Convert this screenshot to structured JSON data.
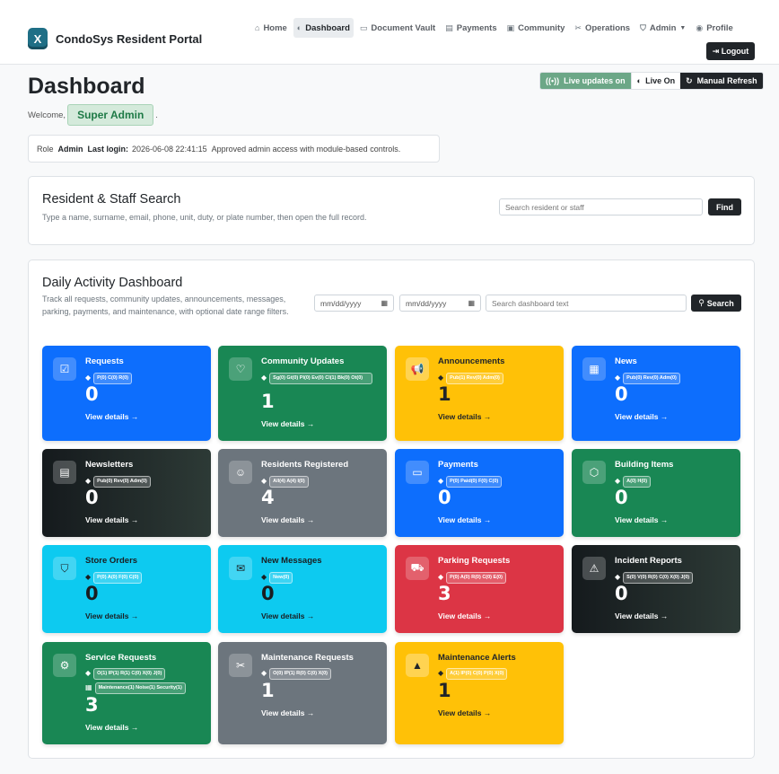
{
  "brand": {
    "logo_text": "X",
    "name": "CondoSys Resident Portal"
  },
  "nav": [
    {
      "label": "Home",
      "icon": "⌂"
    },
    {
      "label": "Dashboard",
      "icon": "◐"
    },
    {
      "label": "Document Vault",
      "icon": "▭"
    },
    {
      "label": "Payments",
      "icon": "▤"
    },
    {
      "label": "Community",
      "icon": "▣"
    },
    {
      "label": "Operations",
      "icon": "✂"
    },
    {
      "label": "Admin",
      "icon": "⛉"
    },
    {
      "label": "Profile",
      "icon": "◉"
    }
  ],
  "logout": "⇥ Logout",
  "page_title": "Dashboard",
  "live": {
    "status": "Live updates on",
    "toggle": "Live On",
    "manual": "Manual Refresh"
  },
  "welcome": {
    "prefix": "Welcome,",
    "name": "Super Admin",
    "suffix": "."
  },
  "role": {
    "role_label": "Role",
    "role_value": "Admin",
    "login_label": "Last login:",
    "login_value": "2026-06-08 22:41:15",
    "note": "Approved admin access with module-based controls."
  },
  "search_card": {
    "title": "Resident & Staff Search",
    "subtitle": "Type a name, surname, email, phone, unit, duty, or plate number, then open the full record.",
    "placeholder": "Search resident or staff",
    "button": "Find"
  },
  "activity": {
    "title": "Daily Activity Dashboard",
    "subtitle": "Track all requests, community updates, announcements, messages, parking, payments, and maintenance, with optional date range filters.",
    "date_from": "mm/dd/yyyy",
    "date_to": "mm/dd/yyyy",
    "search_placeholder": "Search dashboard text",
    "search_button": "Search"
  },
  "tiles": [
    {
      "title": "Requests",
      "icon": "clipboard-check-icon",
      "tags": [
        "P(0) C(0) R(0)"
      ],
      "count": "0",
      "link": "View details →",
      "color": "blue"
    },
    {
      "title": "Community Updates",
      "icon": "chat-heart-icon",
      "tags": [
        "Sg(0) Gt(0) Pl(0) Ev(0) Cl(1) Bk(0) Ot(0)"
      ],
      "count": "1",
      "link": "View details →",
      "color": "green"
    },
    {
      "title": "Announcements",
      "icon": "megaphone-icon",
      "tags": [
        "Pub(1) Rev(0) Adm(0)"
      ],
      "count": "1",
      "link": "View details →",
      "color": "yellow"
    },
    {
      "title": "News",
      "icon": "newspaper-icon",
      "tags": [
        "Pub(0) Rev(0) Adm(0)"
      ],
      "count": "0",
      "link": "View details →",
      "color": "blue"
    },
    {
      "title": "Newsletters",
      "icon": "journal-icon",
      "tags": [
        "Pub(0) Rev(0) Adm(0)"
      ],
      "count": "0",
      "link": "View details →",
      "color": "dark"
    },
    {
      "title": "Residents Registered",
      "icon": "person-check-icon",
      "tags": [
        "All(4) A(4) I(0)"
      ],
      "count": "4",
      "link": "View details →",
      "color": "gray"
    },
    {
      "title": "Payments",
      "icon": "credit-card-icon",
      "tags": [
        "P(0) Paid(0) F(0) C(0)"
      ],
      "count": "0",
      "link": "View details →",
      "color": "blue"
    },
    {
      "title": "Building Items",
      "icon": "box-icon",
      "tags": [
        "A(0) H(0)"
      ],
      "count": "0",
      "link": "View details →",
      "color": "green"
    },
    {
      "title": "Store Orders",
      "icon": "bag-check-icon",
      "tags": [
        "P(0) A(0) F(0) C(0)"
      ],
      "count": "0",
      "link": "View details →",
      "color": "cyan"
    },
    {
      "title": "New Messages",
      "icon": "envelope-open-icon",
      "tags": [
        "New(0)"
      ],
      "count": "0",
      "link": "View details →",
      "color": "cyan"
    },
    {
      "title": "Parking Requests",
      "icon": "car-icon",
      "tags": [
        "P(0) A(0) R(0) C(0) E(0)"
      ],
      "count": "3",
      "link": "View details →",
      "color": "red"
    },
    {
      "title": "Incident Reports",
      "icon": "warning-icon",
      "tags": [
        "S(0) V(0) R(0) C(0) X(0) J(0)"
      ],
      "count": "0",
      "link": "View details →",
      "color": "dark"
    },
    {
      "title": "Service Requests",
      "icon": "tools-circle-icon",
      "tags": [
        "O(1) IP(1) R(1) C(0) X(0) J(0)",
        "Maintenance(1) Noise(1) Security(1)"
      ],
      "count": "3",
      "link": "View details →",
      "color": "green"
    },
    {
      "title": "Maintenance Requests",
      "icon": "wrench-screwdriver-icon",
      "tags": [
        "O(0) IP(1) R(0) C(0) X(0)"
      ],
      "count": "1",
      "link": "View details →",
      "color": "gray"
    },
    {
      "title": "Maintenance Alerts",
      "icon": "cone-icon",
      "tags": [
        "A(1) IP(0) C(0) P(0) X(0)"
      ],
      "count": "1",
      "link": "View details →",
      "color": "yellow"
    }
  ]
}
